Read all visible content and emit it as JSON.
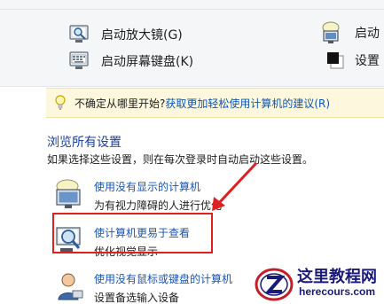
{
  "tools": {
    "magnifier": {
      "label": "启动放大镜(G)",
      "icon": "magnifier-icon"
    },
    "narrator": {
      "label": "启动",
      "icon": "narrator-icon"
    },
    "keyboard": {
      "label": "启动屏幕键盘(K)",
      "icon": "keyboard-icon"
    },
    "contrast": {
      "label": "设置",
      "icon": "high-contrast-icon"
    }
  },
  "tip": {
    "prefix": "不确定从哪里开始?",
    "link": "获取更加轻松使用计算机的建议(R)",
    "icon": "lightbulb-icon"
  },
  "browse": {
    "title": "浏览所有设置",
    "description": "如果选择这些设置，则在每次登录时自动启动这些设置。",
    "items": [
      {
        "title": "使用没有显示的计算机",
        "subtitle": "为有视力障碍的人进行优化",
        "icon": "monitor-speech-icon"
      },
      {
        "title": "使计算机更易于查看",
        "subtitle": "优化视觉显示",
        "icon": "monitor-magnifier-icon"
      },
      {
        "title": "使用没有鼠标或键盘的计算机",
        "subtitle": "设置备选输入设备",
        "icon": "user-input-icon"
      }
    ]
  },
  "watermark": {
    "title": "这里教程网",
    "url": "herecours.com"
  },
  "colors": {
    "accent_link": "#1b56b3",
    "highlight": "#e02020",
    "tip_background": "#fdf8dd"
  }
}
